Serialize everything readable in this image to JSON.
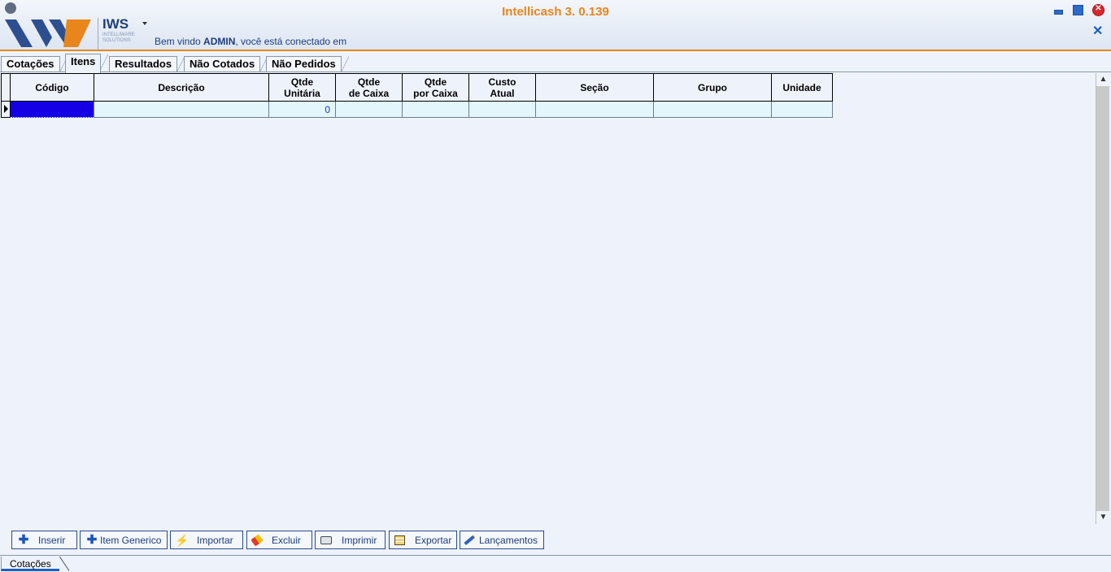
{
  "header": {
    "app_title": "Intellicash 3. 0.139",
    "brand_name": "IWS",
    "brand_sub": "INTELLIWARE SOLUTIONS",
    "welcome_prefix": "Bem vindo ",
    "user": "ADMIN",
    "welcome_suffix": ", você está conectado em"
  },
  "tabs": [
    {
      "label": "Cotações",
      "active": false
    },
    {
      "label": "Itens",
      "active": true
    },
    {
      "label": "Resultados",
      "active": false
    },
    {
      "label": "Não Cotados",
      "active": false
    },
    {
      "label": "Não Pedidos",
      "active": false
    }
  ],
  "grid": {
    "columns": [
      "Código",
      "Descrição",
      "Qtde\nUnitária",
      "Qtde\nde Caixa",
      "Qtde\npor Caixa",
      "Custo\nAtual",
      "Seção",
      "Grupo",
      "Unidade"
    ],
    "rows": [
      [
        "",
        "",
        "0",
        "",
        "",
        "",
        "",
        "",
        ""
      ]
    ]
  },
  "buttons": {
    "inserir": "Inserir",
    "item_generico": "Item Generico",
    "importar": "Importar",
    "excluir": "Excluir",
    "imprimir": "Imprimir",
    "exportar": "Exportar",
    "lancamentos": "Lançamentos"
  },
  "bottom_tab": "Cotações",
  "colors": {
    "accent": "#e8861c",
    "brand": "#1f3d7a",
    "selection": "#1500e6"
  }
}
